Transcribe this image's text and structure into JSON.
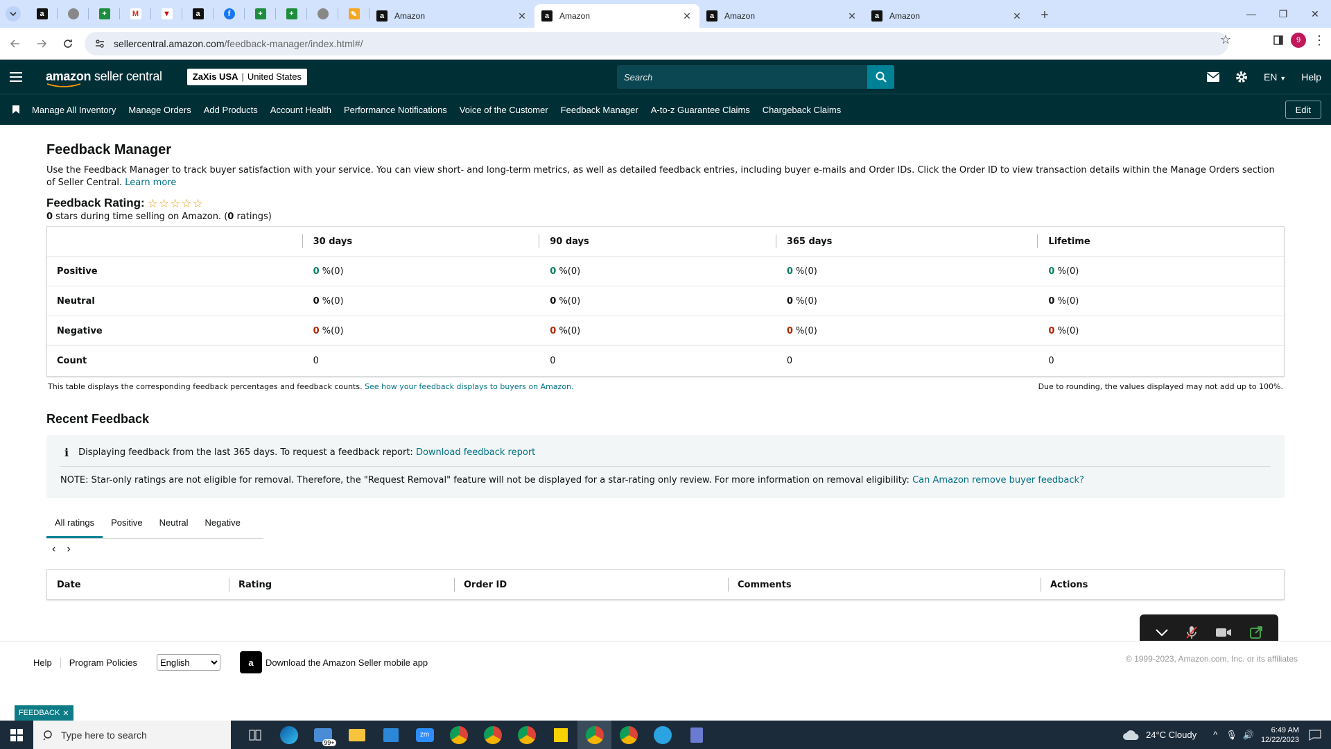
{
  "browser": {
    "tabs": [
      {
        "label": "Amazon",
        "active": false
      },
      {
        "label": "Amazon",
        "active": true
      },
      {
        "label": "Amazon",
        "active": false
      },
      {
        "label": "Amazon",
        "active": false
      }
    ],
    "url_domain": "sellercentral.amazon.com",
    "url_path": "/feedback-manager/index.html#/",
    "profile_initial": "9"
  },
  "header": {
    "logo_brand": "amazon",
    "logo_suffix": " seller central",
    "store_name": "ZaXis USA",
    "store_region": "United States",
    "search_placeholder": "Search",
    "language": "EN",
    "help": "Help"
  },
  "subnav": {
    "links": [
      "Manage All Inventory",
      "Manage Orders",
      "Add Products",
      "Account Health",
      "Performance Notifications",
      "Voice of the Customer",
      "Feedback Manager",
      "A-to-z Guarantee Claims",
      "Chargeback Claims"
    ],
    "edit_label": "Edit"
  },
  "page": {
    "title": "Feedback Manager",
    "description": "Use the Feedback Manager to track buyer satisfaction with your service. You can view short- and long-term metrics, as well as detailed feedback entries, including buyer e-mails and Order IDs. Click the Order ID to view transaction details within the Manage Orders section of Seller Central.",
    "learn_more": "Learn more",
    "rating_label": "Feedback Rating:",
    "rating_stars": 0,
    "stars_value": "0",
    "stars_text_a": " stars during time selling on Amazon. (",
    "ratings_count": "0",
    "stars_text_b": " ratings)"
  },
  "metrics": {
    "columns": [
      "30 days",
      "90 days",
      "365 days",
      "Lifetime"
    ],
    "rows": [
      {
        "label": "Positive",
        "values": [
          "0",
          "0",
          "0",
          "0"
        ],
        "suffix": "%(0)"
      },
      {
        "label": "Neutral",
        "values": [
          "0",
          "0",
          "0",
          "0"
        ],
        "suffix": "%(0)"
      },
      {
        "label": "Negative",
        "values": [
          "0",
          "0",
          "0",
          "0"
        ],
        "suffix": "%(0)"
      },
      {
        "label": "Count",
        "values": [
          "0",
          "0",
          "0",
          "0"
        ]
      }
    ],
    "footnote_left": "This table displays the corresponding feedback percentages and feedback counts.",
    "footnote_link": "See how your feedback displays to buyers on Amazon.",
    "footnote_right": "Due to rounding, the values displayed may not add up to 100%."
  },
  "recent": {
    "title": "Recent Feedback",
    "info_text": "Displaying feedback from the last 365 days. To request a feedback report:",
    "info_link": "Download feedback report",
    "note_text": "NOTE: Star-only ratings are not eligible for removal. Therefore, the \"Request Removal\" feature will not be displayed for a star-rating only review. For more information on removal eligibility:",
    "note_link": "Can Amazon remove buyer feedback?",
    "tabs": [
      "All ratings",
      "Positive",
      "Neutral",
      "Negative"
    ],
    "columns": [
      "Date",
      "Rating",
      "Order ID",
      "Comments",
      "Actions"
    ]
  },
  "footer": {
    "help": "Help",
    "policies": "Program Policies",
    "language_selected": "English",
    "app_text": "Download the Amazon Seller mobile app",
    "copyright": "© 1999-2023, Amazon.com, Inc. or its affiliates",
    "feedback_tag": "FEEDBACK"
  },
  "taskbar": {
    "search_placeholder": "Type here to search",
    "mail_badge": "99+",
    "weather": "24°C  Cloudy",
    "time": "6:49 AM",
    "date": "12/22/2023"
  },
  "colors": {
    "header_bg": "#002f36",
    "accent": "#008296",
    "positive": "#067d62",
    "negative": "#b12704"
  }
}
